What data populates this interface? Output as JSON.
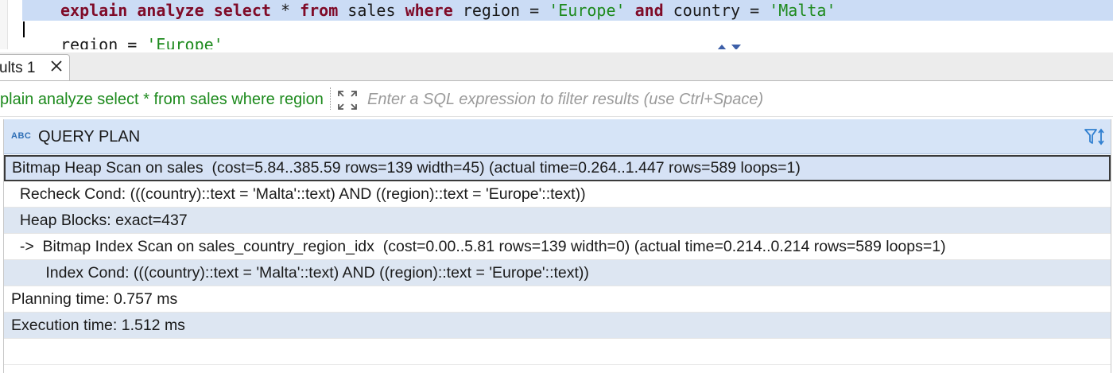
{
  "editor": {
    "line1": {
      "kw_explain": "explain",
      "kw_analyze": "analyze",
      "kw_select": "select",
      "star": "*",
      "kw_from": "from",
      "table": "sales",
      "kw_where": "where",
      "col_region": "region",
      "eq1": "=",
      "val_europe": "'Europe'",
      "kw_and": "and",
      "col_country": "country",
      "eq2": "=",
      "val_malta": "'Malta'"
    },
    "line2": {
      "col_region": "region",
      "eq": "=",
      "val_europe": "'Europe'"
    }
  },
  "results_tab": {
    "label": "ults 1",
    "close_icon": "close-icon"
  },
  "filter_bar": {
    "query_text": "plain analyze select * from sales where region = 'Europe' and country = 'Malta'",
    "expand_icon": "expand-icon",
    "placeholder": "Enter a SQL expression to filter results (use Ctrl+Space)"
  },
  "grid": {
    "column": {
      "type_badge": "ABC",
      "title": "QUERY PLAN",
      "filter_sort_icon": "filter-sort-icon"
    },
    "rows": [
      "Bitmap Heap Scan on sales  (cost=5.84..385.59 rows=139 width=45) (actual time=0.264..1.447 rows=589 loops=1)",
      "  Recheck Cond: (((country)::text = 'Malta'::text) AND ((region)::text = 'Europe'::text))",
      "  Heap Blocks: exact=437",
      "  ->  Bitmap Index Scan on sales_country_region_idx  (cost=0.00..5.81 rows=139 width=0) (actual time=0.214..0.214 rows=589 loops=1)",
      "        Index Cond: (((country)::text = 'Malta'::text) AND ((region)::text = 'Europe'::text))",
      "Planning time: 0.757 ms",
      "Execution time: 1.512 ms"
    ],
    "selected_row": 0
  },
  "colors": {
    "keyword": "#7f0b28",
    "string": "#1d8a1d",
    "current_line": "#cbdcf5",
    "header_bg": "#d6e4f7",
    "alt_row": "#dde6f2"
  }
}
